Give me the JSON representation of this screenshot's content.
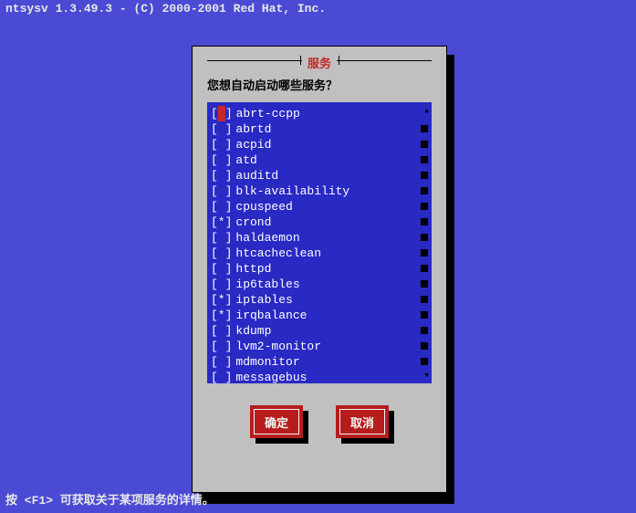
{
  "topbar": "ntsysv 1.3.49.3 - (C) 2000-2001 Red Hat, Inc.",
  "dialog": {
    "title": "服务",
    "prompt": "您想自动启动哪些服务？"
  },
  "services": [
    {
      "name": "abrt-ccpp",
      "checked": false,
      "cursor": true
    },
    {
      "name": "abrtd",
      "checked": false
    },
    {
      "name": "acpid",
      "checked": false
    },
    {
      "name": "atd",
      "checked": false
    },
    {
      "name": "auditd",
      "checked": false
    },
    {
      "name": "blk-availability",
      "checked": false
    },
    {
      "name": "cpuspeed",
      "checked": false
    },
    {
      "name": "crond",
      "checked": true
    },
    {
      "name": "haldaemon",
      "checked": false
    },
    {
      "name": "htcacheclean",
      "checked": false
    },
    {
      "name": "httpd",
      "checked": false
    },
    {
      "name": "ip6tables",
      "checked": false
    },
    {
      "name": "iptables",
      "checked": true
    },
    {
      "name": "irqbalance",
      "checked": true
    },
    {
      "name": "kdump",
      "checked": false
    },
    {
      "name": "lvm2-monitor",
      "checked": false
    },
    {
      "name": "mdmonitor",
      "checked": false
    },
    {
      "name": "messagebus",
      "checked": false
    }
  ],
  "buttons": {
    "ok": "确定",
    "cancel": "取消"
  },
  "help": "按 <F1> 可获取关于某项服务的详情。",
  "colors": {
    "background": "#4a4ad4",
    "panel": "#c0c0c0",
    "listbox": "#2929c4",
    "button": "#b71c1c",
    "title": "#c62828"
  }
}
